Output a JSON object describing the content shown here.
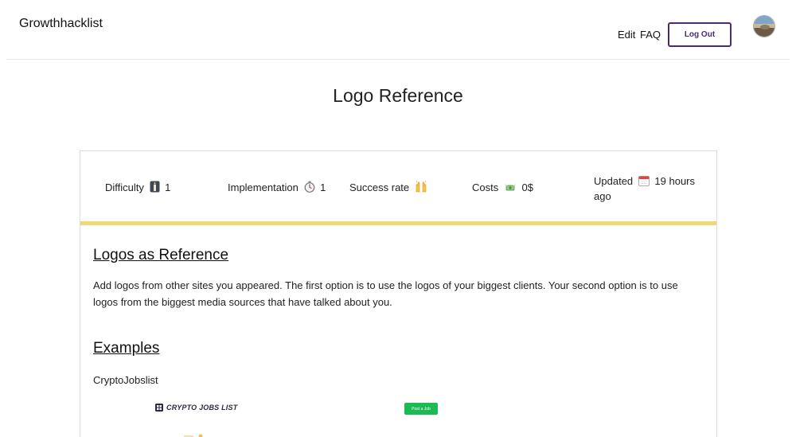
{
  "header": {
    "brand": "Growthhacklist",
    "nav": {
      "edit": "Edit",
      "faq": "FAQ",
      "logout": "Log Out"
    }
  },
  "page": {
    "title": "Logo Reference"
  },
  "stats": {
    "difficulty_label": "Difficulty",
    "difficulty_value": "1",
    "implementation_label": "Implementation",
    "implementation_value": "1",
    "success_label": "Success rate",
    "costs_label": "Costs",
    "costs_value": "0$",
    "updated_label": "Updated",
    "updated_value": "19 hours ago"
  },
  "content": {
    "section1_title": "Logos as Reference",
    "section1_text": "Add logos from other sites you appeared. The first option is to use the logos of your biggest clients. Your second option is to use logos from the biggest media sources that have talked about you.",
    "section2_title": "Examples",
    "example1_name": "CryptoJobslist",
    "example1_logo_text": "CRYPTO JOBS LIST",
    "example1_button_text": "Post a Job"
  },
  "colors": {
    "accent_border": "#4b2a7a",
    "yellow_bar": "#f0d872",
    "post_button": "#1db954"
  },
  "icons": {
    "difficulty": "candle-emoji",
    "implementation": "stopwatch-emoji",
    "success": "raised-hands-emoji",
    "costs": "money-with-wings-emoji",
    "updated": "calendar-emoji"
  }
}
